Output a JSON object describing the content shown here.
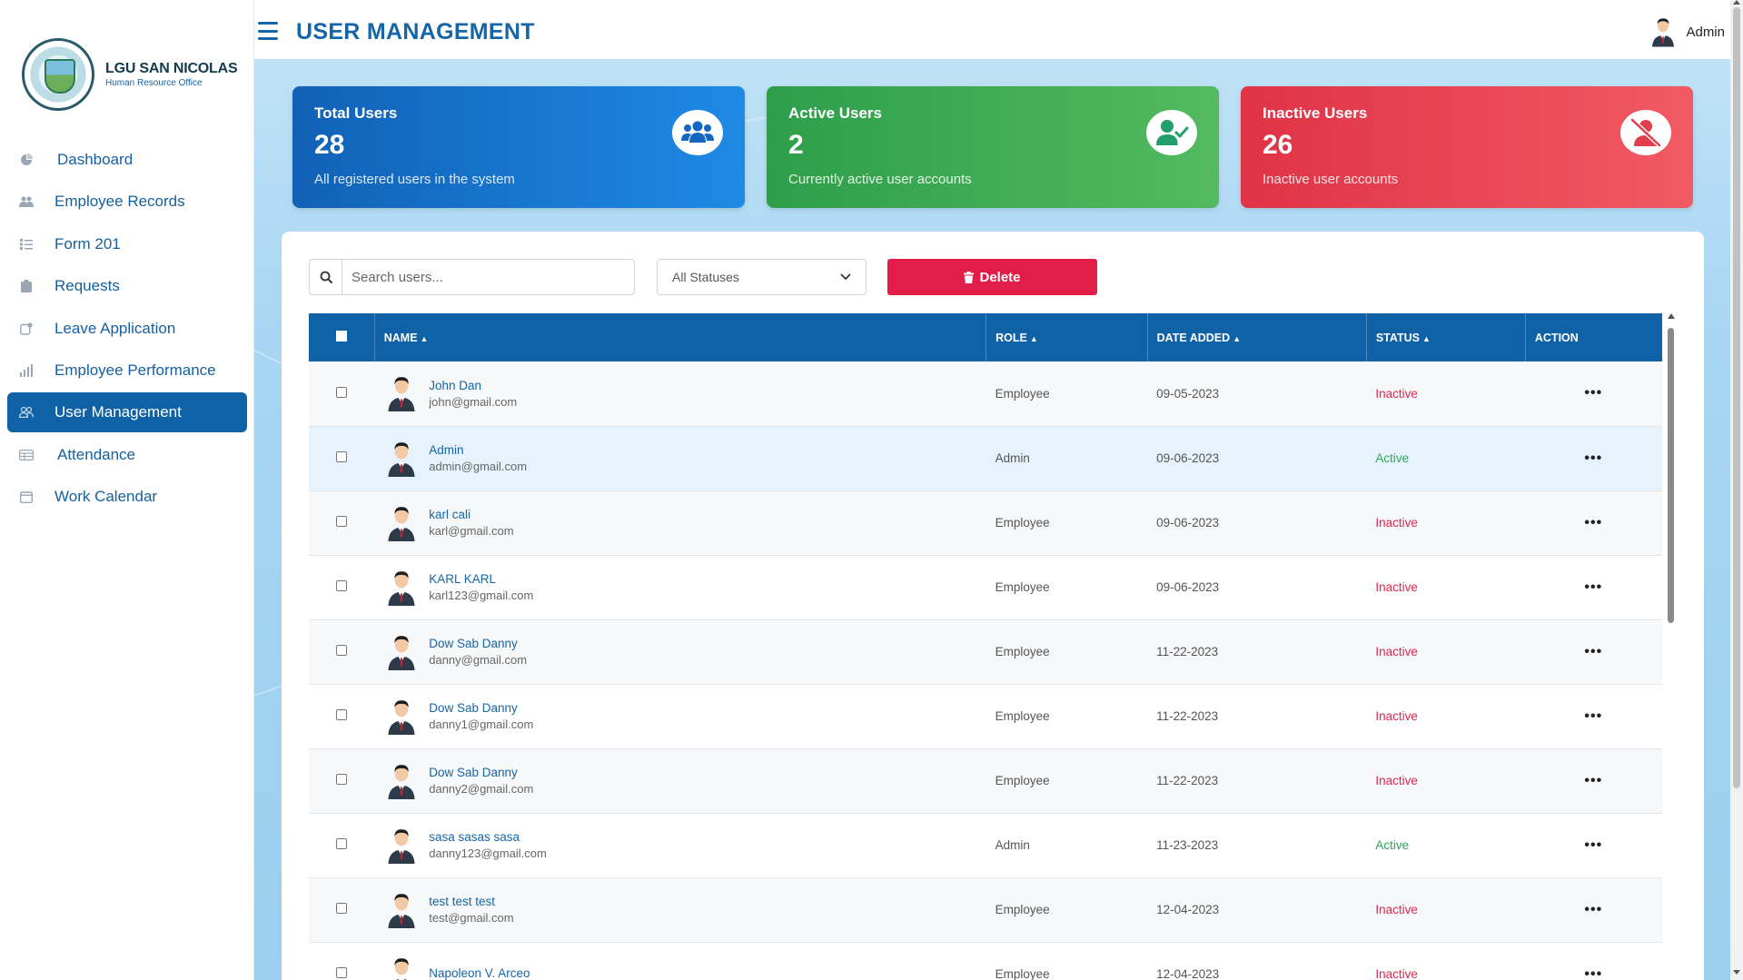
{
  "brand": {
    "name": "LGU SAN NICOLAS",
    "subtitle": "Human Resource Office"
  },
  "sidebar": {
    "items": [
      {
        "label": "Dashboard",
        "icon": "pie-chart-icon",
        "active": false
      },
      {
        "label": "Employee Records",
        "icon": "users-icon",
        "active": false
      },
      {
        "label": "Form 201",
        "icon": "list-icon",
        "active": false
      },
      {
        "label": "Requests",
        "icon": "clipboard-icon",
        "active": false
      },
      {
        "label": "Leave Application",
        "icon": "leave-icon",
        "active": false
      },
      {
        "label": "Employee Performance",
        "icon": "bar-chart-icon",
        "active": false
      },
      {
        "label": "User Management",
        "icon": "user-group-icon",
        "active": true
      },
      {
        "label": "Attendance",
        "icon": "table-icon",
        "active": false
      },
      {
        "label": "Work Calendar",
        "icon": "calendar-icon",
        "active": false
      }
    ]
  },
  "header": {
    "title": "USER MANAGEMENT",
    "user_name": "Admin"
  },
  "cards": [
    {
      "title": "Total Users",
      "value": "28",
      "desc": "All registered users in the system",
      "icon": "users-group-icon",
      "color": "#1677d6"
    },
    {
      "title": "Active Users",
      "value": "2",
      "desc": "Currently active user accounts",
      "icon": "user-check-icon",
      "color": "#3fae52"
    },
    {
      "title": "Inactive Users",
      "value": "26",
      "desc": "Inactive user accounts",
      "icon": "user-slash-icon",
      "color": "#e8434f"
    }
  ],
  "toolbar": {
    "search_placeholder": "Search users...",
    "status_filter": "All Statuses",
    "delete_label": "Delete"
  },
  "table": {
    "columns": [
      "NAME",
      "ROLE",
      "DATE ADDED",
      "STATUS",
      "ACTION"
    ],
    "rows": [
      {
        "name": "John Dan",
        "email": "john@gmail.com",
        "role": "Employee",
        "date": "09-05-2023",
        "status": "Inactive"
      },
      {
        "name": "Admin",
        "email": "admin@gmail.com",
        "role": "Admin",
        "date": "09-06-2023",
        "status": "Active"
      },
      {
        "name": "karl cali",
        "email": "karl@gmail.com",
        "role": "Employee",
        "date": "09-06-2023",
        "status": "Inactive"
      },
      {
        "name": "KARL KARL",
        "email": "karl123@gmail.com",
        "role": "Employee",
        "date": "09-06-2023",
        "status": "Inactive"
      },
      {
        "name": "Dow Sab Danny",
        "email": "danny@gmail.com",
        "role": "Employee",
        "date": "11-22-2023",
        "status": "Inactive"
      },
      {
        "name": "Dow Sab Danny",
        "email": "danny1@gmail.com",
        "role": "Employee",
        "date": "11-22-2023",
        "status": "Inactive"
      },
      {
        "name": "Dow Sab Danny",
        "email": "danny2@gmail.com",
        "role": "Employee",
        "date": "11-22-2023",
        "status": "Inactive"
      },
      {
        "name": "sasa sasas sasa",
        "email": "danny123@gmail.com",
        "role": "Admin",
        "date": "11-23-2023",
        "status": "Active"
      },
      {
        "name": "test test test",
        "email": "test@gmail.com",
        "role": "Employee",
        "date": "12-04-2023",
        "status": "Inactive"
      },
      {
        "name": "Napoleon V. Arceo",
        "email": "",
        "role": "Employee",
        "date": "12-04-2023",
        "status": "Inactive"
      }
    ]
  },
  "colors": {
    "primary": "#1062a6",
    "danger": "#e11d48",
    "active": "#2ea65a",
    "inactive": "#e0264f"
  }
}
